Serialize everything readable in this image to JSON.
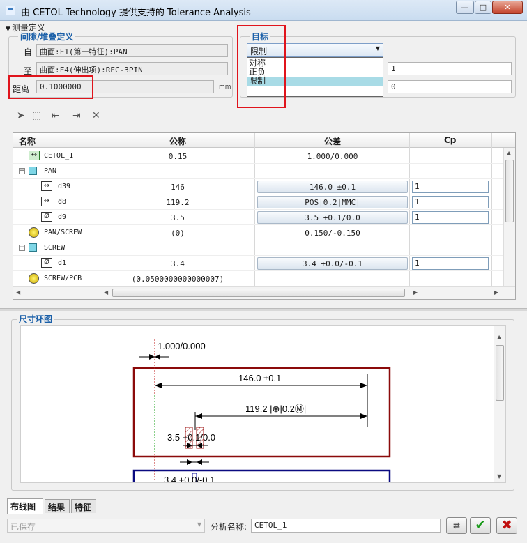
{
  "window": {
    "title": "由 CETOL Technology 提供支持的 Tolerance Analysis",
    "minimize": "—",
    "maximize": "□",
    "close": "✕"
  },
  "measurement": {
    "section_title": "测量定义",
    "gap_group_title": "间隙/堆叠定义",
    "from_label": "自",
    "from_value": "曲面:F1(第一特征):PAN",
    "to_label": "至",
    "to_value": "曲面:F4(伸出项):REC-3PIN",
    "distance_label": "距离",
    "distance_value": "0.1000000",
    "distance_unit": "mm"
  },
  "target": {
    "group_title": "目标",
    "selected": "限制",
    "options": [
      "对称",
      "正负",
      "限制"
    ],
    "field1_value": "1",
    "field2_value": "0"
  },
  "table": {
    "headers": [
      "名称",
      "公称",
      "公差",
      "Cp"
    ],
    "rows": [
      {
        "name": "CETOL_1",
        "nominal": "0.15",
        "tolerance": "1.000/0.000",
        "cp": ""
      },
      {
        "name": "PAN",
        "nominal": "",
        "tolerance": "",
        "cp": ""
      },
      {
        "name": "d39",
        "nominal": "146",
        "tolerance": "146.0 ±0.1",
        "cp": "1"
      },
      {
        "name": "d8",
        "nominal": "119.2",
        "tolerance": "POS|0.2|MMC|",
        "cp": "1"
      },
      {
        "name": "d9",
        "nominal": "3.5",
        "tolerance": "3.5 +0.1/0.0",
        "cp": "1"
      },
      {
        "name": "PAN/SCREW",
        "nominal": "(0)",
        "tolerance": "0.150/-0.150",
        "cp": ""
      },
      {
        "name": "SCREW",
        "nominal": "",
        "tolerance": "",
        "cp": ""
      },
      {
        "name": "d1",
        "nominal": "3.4",
        "tolerance": "3.4 +0.0/-0.1",
        "cp": "1"
      },
      {
        "name": "SCREW/PCB",
        "nominal": "(0.0500000000000007)",
        "tolerance": "",
        "cp": ""
      }
    ]
  },
  "diagram": {
    "title": "尺寸环图",
    "label_gap": "1.000/0.000",
    "label_146": "146.0 ±0.1",
    "label_119": "119.2 |⊕|0.2Ⓜ|",
    "label_35": "3.5 +0.1/0.0",
    "label_34": "3.4 +0.0/-0.1"
  },
  "tabs": [
    "布线图",
    "结果",
    "特征"
  ],
  "footer": {
    "status": "已保存",
    "analysis_label": "分析名称:",
    "analysis_value": "CETOL_1"
  }
}
